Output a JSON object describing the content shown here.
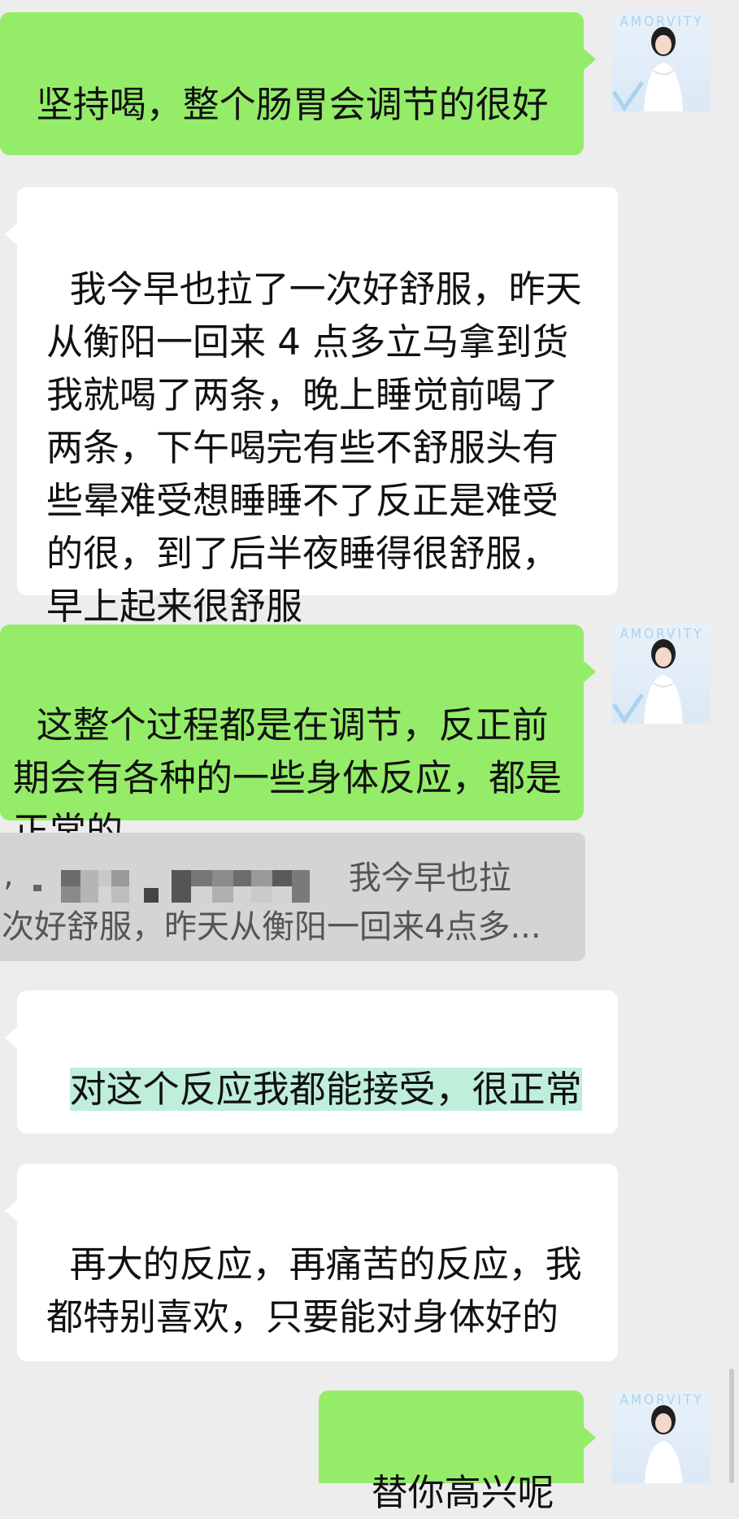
{
  "messages": [
    {
      "id": "m1",
      "side": "sent",
      "text": "坚持喝，整个肠胃会调节的很好"
    },
    {
      "id": "m2",
      "side": "received",
      "text": "我今早也拉了一次好舒服，昨天从衡阳一回来 4 点多立马拿到货我就喝了两条，晚上睡觉前喝了两条，下午喝完有些不舒服头有些晕难受想睡睡不了反正是难受的很，到了后半夜睡得很舒服，早上起来很舒服"
    },
    {
      "id": "m3",
      "side": "sent",
      "text": "这整个过程都是在调节，反正前期会有各种的一些身体反应，都是正常的"
    },
    {
      "id": "q1",
      "type": "quote",
      "prefix": ",",
      "line1_text": "我今早也拉",
      "line2_text": "次好舒服，昨天从衡阳一回来4点多..."
    },
    {
      "id": "m4",
      "side": "received",
      "text": "对这个反应我都能接受，很正常",
      "highlighted": true
    },
    {
      "id": "m5",
      "side": "received",
      "text": "再大的反应，再痛苦的反应，我都特别喜欢，只要能对身体好的"
    },
    {
      "id": "m6",
      "side": "sent",
      "text": "替你高兴呢"
    }
  ],
  "avatar": {
    "brand_text": "AMORVITY"
  },
  "colors": {
    "background": "#ededed",
    "sent_bubble": "#95ec69",
    "received_bubble": "#ffffff",
    "quote_background": "#d4d4d4",
    "highlight": "#bfeedb"
  }
}
